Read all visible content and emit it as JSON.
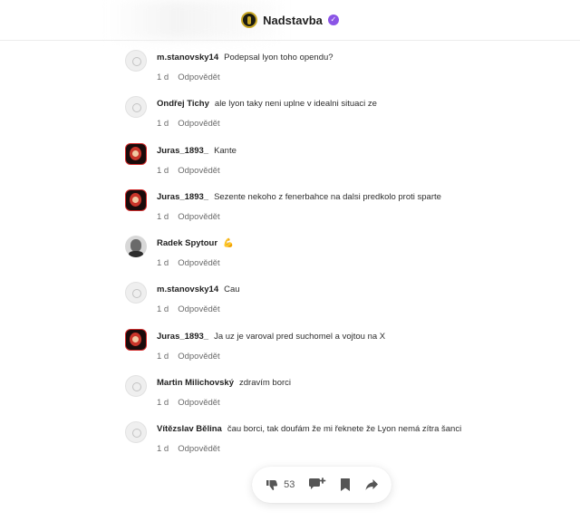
{
  "header": {
    "channel_name": "Nadstavba"
  },
  "comments": [
    {
      "author": "m.stanovsky14",
      "avatar": "default-avatar",
      "text": "Podepsal lyon toho opendu?",
      "time": "1 d",
      "reply": "Odpovědět"
    },
    {
      "author": "Ondřej Tichy",
      "avatar": "default-avatar",
      "text": "ale lyon taky neni uplne v idealni situaci ze",
      "time": "1 d",
      "reply": "Odpovědět"
    },
    {
      "author": "Juras_1893_",
      "avatar": "juras-avatar",
      "text": "Kante",
      "time": "1 d",
      "reply": "Odpovědět"
    },
    {
      "author": "Juras_1893_",
      "avatar": "juras-avatar",
      "text": "Sezente nekoho z fenerbahce na dalsi predkolo proti sparte",
      "time": "1 d",
      "reply": "Odpovědět"
    },
    {
      "author": "Radek Spytour",
      "avatar": "radek-avatar",
      "text": "💪",
      "time": "1 d",
      "reply": "Odpovědět"
    },
    {
      "author": "m.stanovsky14",
      "avatar": "default-avatar",
      "text": "Cau",
      "time": "1 d",
      "reply": "Odpovědět"
    },
    {
      "author": "Juras_1893_",
      "avatar": "juras-avatar",
      "text": "Ja uz je varoval pred suchomel a vojtou na X",
      "time": "1 d",
      "reply": "Odpovědět"
    },
    {
      "author": "Martin Milichovský",
      "avatar": "default-avatar",
      "text": "zdravím borci",
      "time": "1 d",
      "reply": "Odpovědět"
    },
    {
      "author": "Vítězslav Bělina",
      "avatar": "default-avatar",
      "text": "čau borci, tak doufám že mi řeknete že Lyon nemá zítra šanci",
      "time": "1 d",
      "reply": "Odpovědět"
    }
  ],
  "actions": {
    "like_count": "53",
    "icons": [
      "thumbs-down-icon",
      "add-comment-icon",
      "bookmark-icon",
      "share-icon"
    ]
  },
  "colors": {
    "verified": "#8b55e6",
    "brand_gold": "#c9a826",
    "muted_text": "#6b6b6b"
  }
}
